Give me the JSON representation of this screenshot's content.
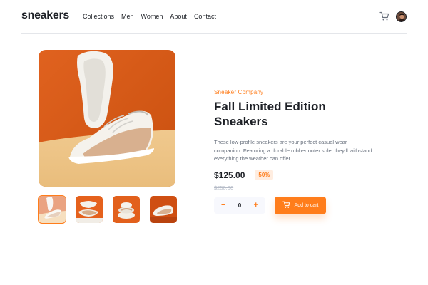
{
  "brand": {
    "logo": "sneakers"
  },
  "nav": {
    "items": [
      "Collections",
      "Men",
      "Women",
      "About",
      "Contact"
    ]
  },
  "header": {
    "cart_icon": "cart-icon"
  },
  "gallery": {
    "thumbnail_count": 4,
    "active_thumbnail": 1
  },
  "product": {
    "company": "Sneaker Company",
    "title": "Fall Limited Edition Sneakers",
    "description": "These low-profile sneakers are your perfect casual wear companion. Featuring a durable rubber outer sole, they'll withstand everything the weather can offer.",
    "price": "$125.00",
    "discount": "50%",
    "original_price": "$250.00"
  },
  "quantity": {
    "minus": "−",
    "value": "0",
    "plus": "+"
  },
  "cart_button": {
    "label": "Add to cart",
    "icon": "cart-icon"
  },
  "colors": {
    "accent": "#ff7d1b",
    "accent_pale": "#ffede0",
    "text_dark": "#1d2026",
    "text_muted": "#68707d"
  }
}
